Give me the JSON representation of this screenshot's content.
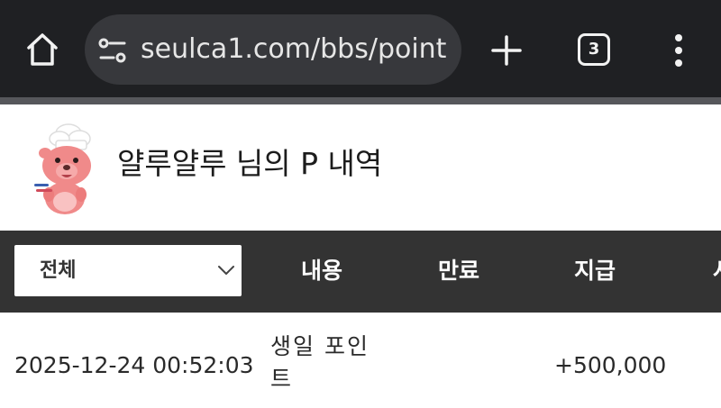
{
  "browser": {
    "url": "seulca1.com/bbs/point",
    "tab_count": "3",
    "icons": {
      "home": "home-icon",
      "site_info": "tune-icon",
      "new_tab": "plus-icon",
      "tabs": "tab-switcher-icon",
      "menu": "more-vert-icon"
    },
    "colors": {
      "toolbar_bg": "#1f2023",
      "url_bg": "#37383c"
    }
  },
  "page": {
    "title": "얄루얄루 님의 P 내역",
    "avatar_icon": "pink-chef-mascot-icon"
  },
  "table": {
    "filter": {
      "selected": "전체"
    },
    "columns": [
      "내용",
      "만료",
      "지급",
      "사"
    ],
    "rows": [
      {
        "datetime": "2025-12-24 00:52:03",
        "content": "생일 포인트",
        "expiry": "",
        "amount": "+500,000"
      }
    ],
    "colors": {
      "header_bg": "#333333",
      "header_text": "#ffffff"
    }
  }
}
